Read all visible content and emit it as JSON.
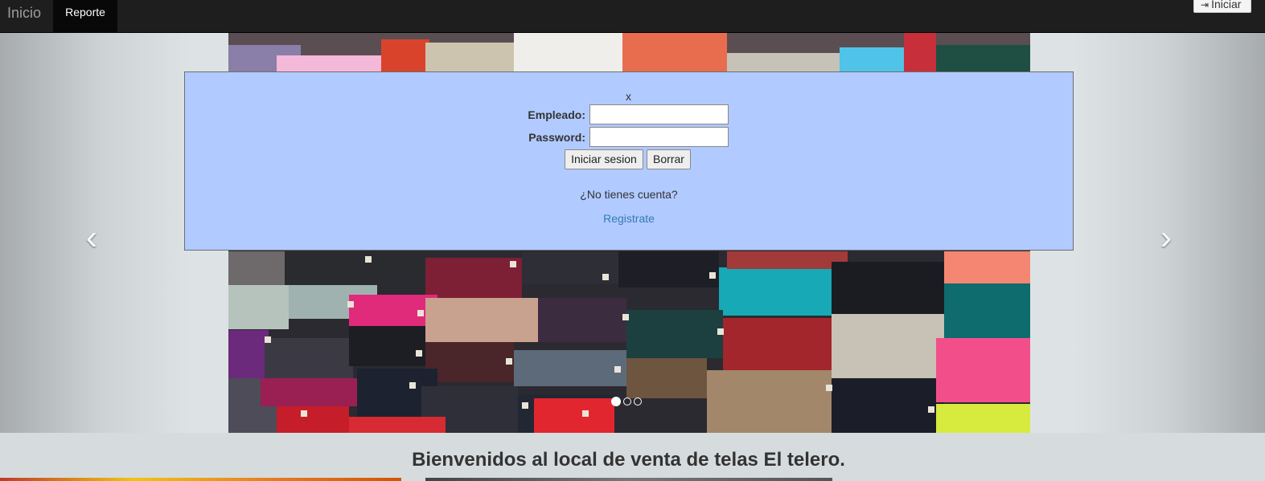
{
  "navbar": {
    "brand": "Inicio",
    "active_tab": "Reporte",
    "login_label": "Iniciar",
    "login_icon": "sign-in-icon"
  },
  "carousel": {
    "prev_icon": "chevron-left-icon",
    "next_icon": "chevron-right-icon",
    "indicator_count": 3,
    "active_indicator": 1
  },
  "login_modal": {
    "close_label": "x",
    "employee_label": "Empleado:",
    "employee_value": "",
    "password_label": "Password:",
    "password_value": "",
    "submit_label": "Iniciar sesion",
    "clear_label": "Borrar",
    "no_account_text": "¿No tienes cuenta?",
    "register_link": "Registrate"
  },
  "welcome_text": "Bienvenidos al local de venta de telas El telero.",
  "colors": {
    "modal_bg": "#b1caff",
    "navbar_bg": "#1e1e1e",
    "link": "#337ab7"
  }
}
